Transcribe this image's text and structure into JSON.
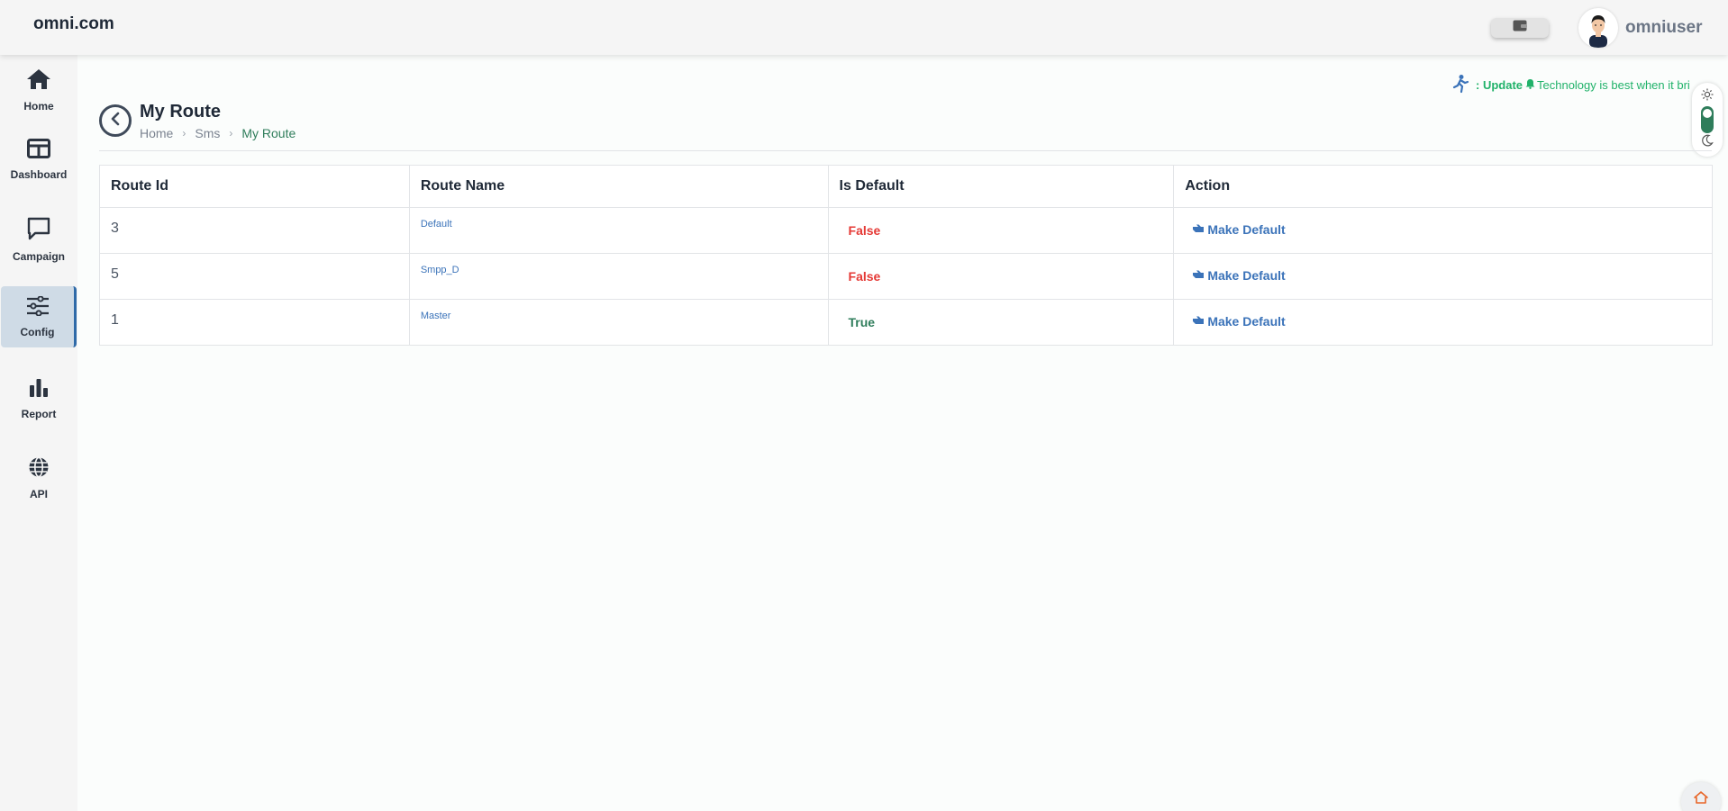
{
  "header": {
    "brand": "omni.com",
    "username": "omniuser",
    "wallet_icon": "wallet-icon",
    "avatar_icon": "user-avatar"
  },
  "sidebar": {
    "items": [
      {
        "label": "Home",
        "icon": "home-icon"
      },
      {
        "label": "Dashboard",
        "icon": "dashboard-icon"
      },
      {
        "label": "Campaign",
        "icon": "chat-icon"
      },
      {
        "label": "Config",
        "icon": "sliders-icon",
        "active": true
      },
      {
        "label": "Report",
        "icon": "bar-chart-icon"
      },
      {
        "label": "API",
        "icon": "globe-icon"
      }
    ]
  },
  "notice": {
    "prefix": ": Update",
    "text": "Technology is best when it bri"
  },
  "page": {
    "title": "My Route",
    "breadcrumb": [
      "Home",
      "Sms",
      "My Route"
    ]
  },
  "table": {
    "headers": [
      "Route Id",
      "Route Name",
      "Is Default",
      "Action"
    ],
    "rows": [
      {
        "id": "3",
        "name": "Default",
        "is_default": "False",
        "action": "Make Default"
      },
      {
        "id": "5",
        "name": "Smpp_D",
        "is_default": "False",
        "action": "Make Default"
      },
      {
        "id": "1",
        "name": "Master",
        "is_default": "True",
        "action": "Make Default"
      }
    ]
  },
  "colors": {
    "accent_green": "#2f7d5b",
    "false_red": "#e53935",
    "link_blue": "#3b73b9"
  }
}
